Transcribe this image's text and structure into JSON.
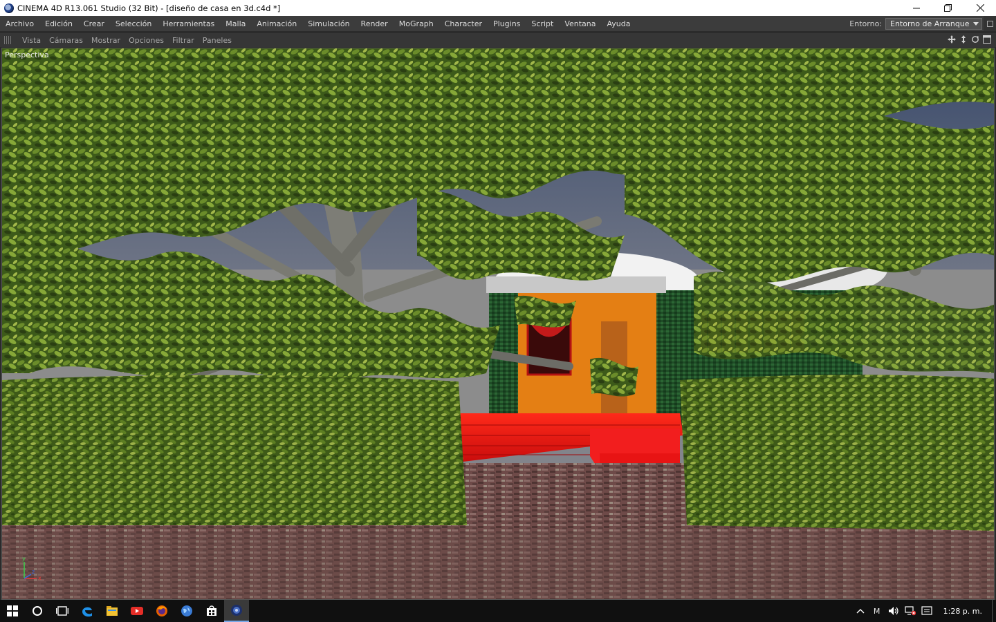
{
  "window": {
    "title": "CINEMA 4D R13.061 Studio (32 Bit) - [diseño de casa en 3d.c4d *]",
    "controls": [
      "minimize-icon",
      "restore-icon",
      "close-icon"
    ]
  },
  "menubar": {
    "items": [
      "Archivo",
      "Edición",
      "Crear",
      "Selección",
      "Herramientas",
      "Malla",
      "Animación",
      "Simulación",
      "Render",
      "MoGraph",
      "Character",
      "Plugins",
      "Script",
      "Ventana",
      "Ayuda"
    ],
    "environment_label": "Entorno:",
    "environment_value": "Entorno de Arranque"
  },
  "viewport_menu": {
    "items": [
      "Vista",
      "Cámaras",
      "Mostrar",
      "Opciones",
      "Filtrar",
      "Paneles"
    ],
    "nav_icons": [
      "move-view-icon",
      "dolly-view-icon",
      "rotate-view-icon",
      "maximize-view-icon"
    ]
  },
  "viewport": {
    "label": "Perspectiva",
    "axis": {
      "y": "y",
      "x": "x",
      "z": "z"
    },
    "colors": {
      "sky": "#5d6b8a",
      "ground": "#6b4a48",
      "hedge": "#4e6b22",
      "foliage": "#3f5a1c",
      "house_orange": "#e07a10",
      "house_green": "#1f4a2a",
      "steps_red": "#e01616",
      "trunk": "#8d8d86"
    }
  },
  "taskbar": {
    "icons": [
      "windows-start-icon",
      "search-icon",
      "task-view-icon",
      "edge-icon",
      "file-explorer-icon",
      "youtube-icon",
      "firefox-icon",
      "globe-icon",
      "store-icon",
      "cinema4d-icon"
    ],
    "tray_icons": [
      "chevron-up-icon",
      "meet-icon",
      "volume-icon",
      "network-icon",
      "notification-icon"
    ],
    "tray_m_label": "M",
    "clock": "1:28 p. m."
  }
}
